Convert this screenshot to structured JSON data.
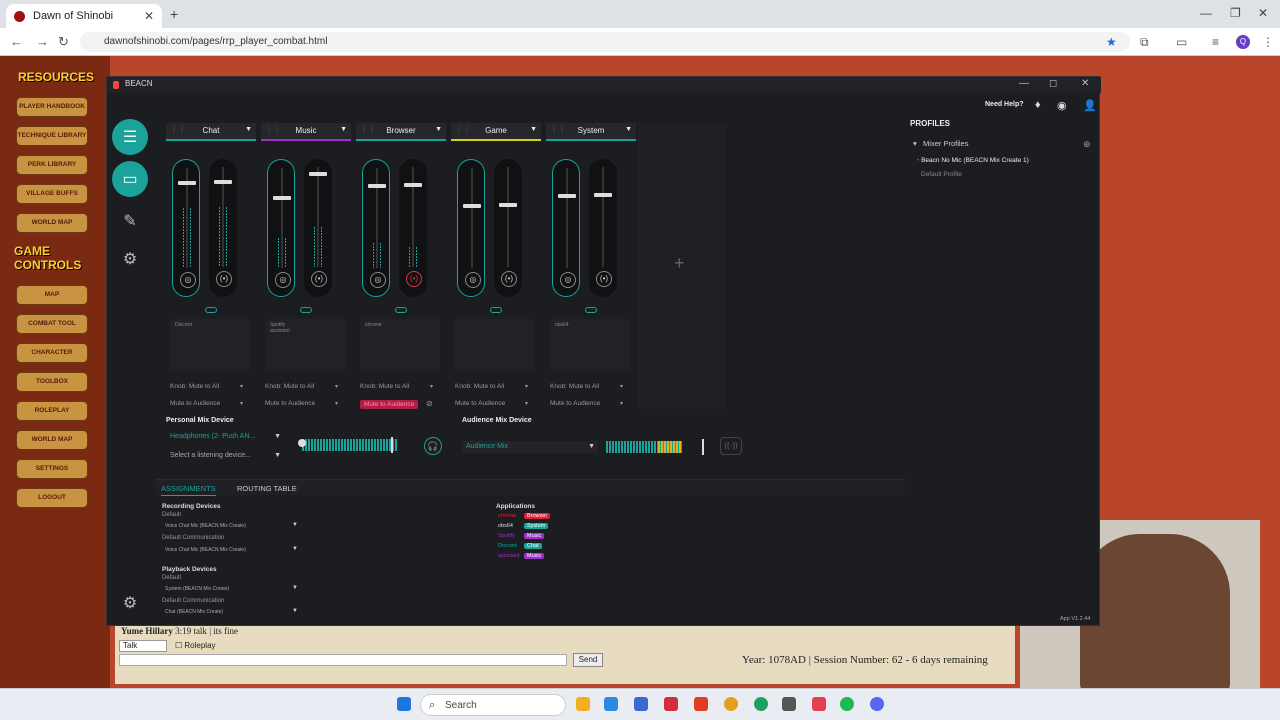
{
  "browser": {
    "tab_title": "Dawn of Shinobi",
    "url": "dawnofshinobi.com/pages/rrp_player_combat.html"
  },
  "site": {
    "sidebar_heading_1": "RESOURCES",
    "resources": [
      "PLAYER HANDBOOK",
      "TECHNIQUE LIBRARY",
      "PERK LIBRARY",
      "VILLAGE BUFFS",
      "WORLD MAP"
    ],
    "sidebar_heading_2": "GAME CONTROLS",
    "controls": [
      "MAP",
      "COMBAT TOOL",
      "CHARACTER",
      "TOOLBOX",
      "ROLEPLAY",
      "WORLD MAP",
      "SETTINGS",
      "LOGOUT"
    ],
    "chat_name": "Yume Hillary",
    "chat_meta": "3:19",
    "chat_type": "talk",
    "chat_text": "its fine",
    "chat_mode": "Talk",
    "roleplay_label": "Roleplay",
    "send_label": "Send",
    "status_line": "Year: 1078AD | Session Number: 62 - 6 days remaining"
  },
  "beacn": {
    "title": "BEACN",
    "need_help": "Need Help?",
    "channels": [
      {
        "name": "Chat",
        "color": "#19a39a",
        "app": "Discord",
        "p_knob": 0.13,
        "a_knob": 0.13,
        "p_meter": 0.6,
        "a_meter": 0.6
      },
      {
        "name": "Music",
        "color": "#9b30d0",
        "app": "Spotify",
        "app2": "assistant",
        "p_knob": 0.28,
        "a_knob": 0.05,
        "p_meter": 0.3,
        "a_meter": 0.4
      },
      {
        "name": "Browser",
        "color": "#19a39a",
        "app": "chrome",
        "p_knob": 0.16,
        "a_knob": 0.16,
        "p_meter": 0.25,
        "a_meter": 0.2,
        "a_muted": true
      },
      {
        "name": "Game",
        "color": "#d8d020",
        "app": "",
        "p_knob": 0.36,
        "a_knob": 0.36,
        "p_meter": 0,
        "a_meter": 0
      },
      {
        "name": "System",
        "color": "#19a39a",
        "app": "obs64",
        "p_knob": 0.26,
        "a_knob": 0.26,
        "p_meter": 0,
        "a_meter": 0
      }
    ],
    "knob_label": "Knob: Mute to All",
    "mute_label": "Mute to Audience",
    "personal_mix_label": "Personal Mix Device",
    "personal_device": "Headphones (2- Push AN...",
    "listening_placeholder": "Select a listening device...",
    "audience_mix_label": "Audience Mix Device",
    "audience_device": "Audience Mix",
    "tab_assignments": "ASSIGNMENTS",
    "tab_routing": "ROUTING TABLE",
    "recording_devices": "Recording Devices",
    "default_label": "Default",
    "default_comm_label": "Default Communication",
    "rec_default": "Voice Chat Mic (BEACN Mix Create)",
    "rec_comm": "Voice Chat Mic (BEACN Mix Create)",
    "playback_devices": "Playback Devices",
    "play_default": "System (BEACN Mix Create)",
    "play_comm": "Chat (BEACN Mix Create)",
    "applications_label": "Applications",
    "apps": [
      {
        "name": "chrome",
        "tag": "Browser",
        "color": "#e0203a"
      },
      {
        "name": "obs64",
        "tag": "System",
        "color": "#19a39a"
      },
      {
        "name": "Spotify",
        "tag": "Music",
        "color": "#9b30d0"
      },
      {
        "name": "Discord",
        "tag": "Chat",
        "color": "#19a39a"
      },
      {
        "name": "assistant",
        "tag": "Music",
        "color": "#9b30d0"
      }
    ],
    "profiles_heading": "PROFILES",
    "mixer_profiles": "Mixer Profiles",
    "profile_name": "Beacn No Mic (BEACN Mix Create 1)",
    "default_profile": "Default Profile",
    "version": "App V1.2.44"
  },
  "taskbar": {
    "search": "Search"
  }
}
